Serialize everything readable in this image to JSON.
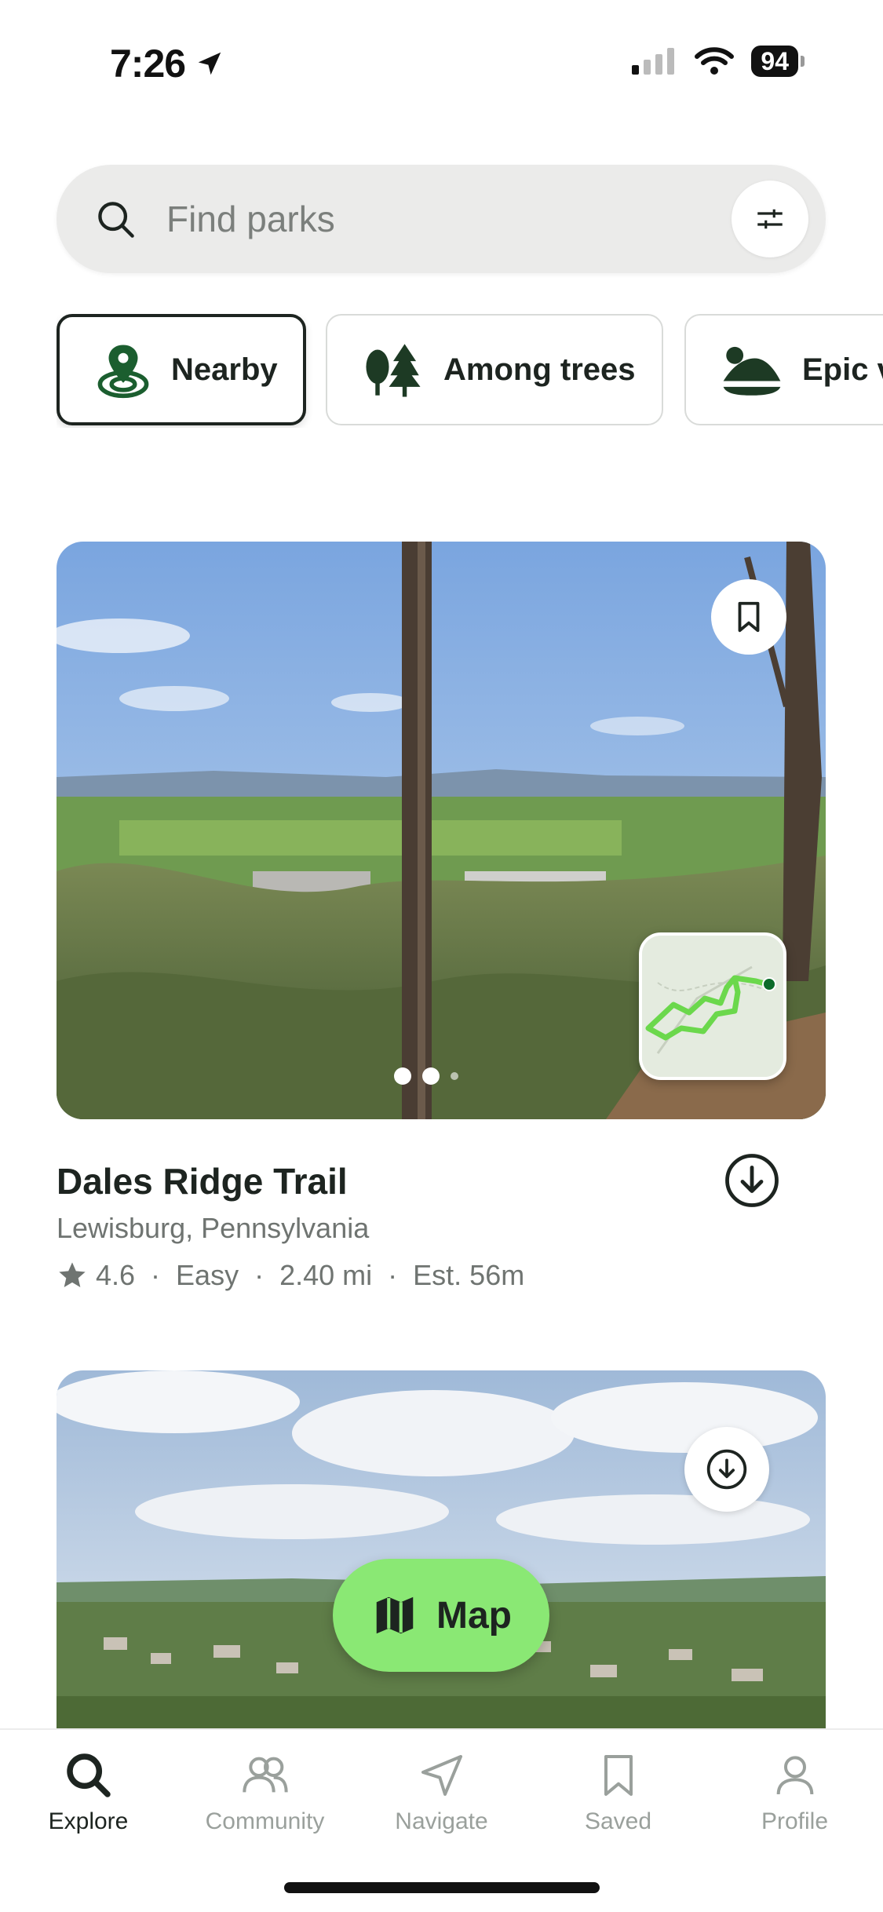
{
  "status_bar": {
    "time": "7:26",
    "battery": "94"
  },
  "search": {
    "placeholder": "Find parks"
  },
  "chips": [
    {
      "label": "Nearby",
      "active": true
    },
    {
      "label": "Among trees",
      "active": false
    },
    {
      "label": "Epic v",
      "active": false
    }
  ],
  "trail": {
    "title": "Dales Ridge Trail",
    "location": "Lewisburg, Pennsylvania",
    "rating": "4.6",
    "difficulty": "Easy",
    "distance": "2.40 mi",
    "estimate": "Est. 56m",
    "photo_count": 3,
    "current_photo": 1
  },
  "map_button": {
    "label": "Map"
  },
  "tabs": [
    {
      "label": "Explore",
      "icon": "search-icon",
      "active": true
    },
    {
      "label": "Community",
      "icon": "people-icon",
      "active": false
    },
    {
      "label": "Navigate",
      "icon": "navigate-icon",
      "active": false
    },
    {
      "label": "Saved",
      "icon": "bookmark-icon",
      "active": false
    },
    {
      "label": "Profile",
      "icon": "person-icon",
      "active": false
    }
  ],
  "colors": {
    "accent_green": "#8ae874",
    "text_dark": "#1d2420",
    "text_muted": "#6f7471",
    "route_green": "#6bd84c"
  }
}
